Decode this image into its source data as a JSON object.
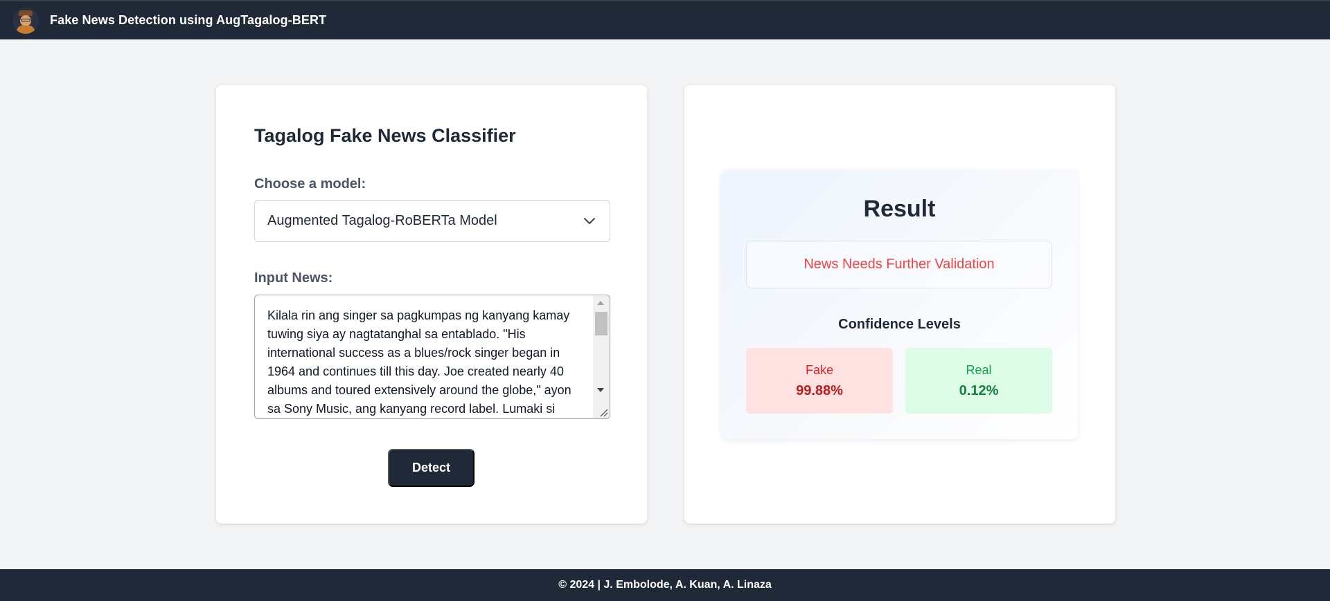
{
  "header": {
    "app_title": "Fake News Detection using AugTagalog-BERT",
    "logo_icon": "avatar-logo-icon"
  },
  "classifier": {
    "title": "Tagalog Fake News Classifier",
    "model_label": "Choose a model:",
    "model_selected": "Augmented Tagalog-RoBERTa Model",
    "news_label": "Input News:",
    "news_text": "Kilala rin ang singer sa pagkumpas ng kanyang kamay tuwing siya ay nagtatanghal sa entablado. \"His international success as a blues/rock singer began in 1964 and continues till this day. Joe created nearly 40 albums and toured extensively around the globe,\" ayon sa Sony Music, ang kanyang record label. Lumaki si",
    "detect_label": "Detect"
  },
  "result": {
    "title": "Result",
    "verdict": "News Needs Further Validation",
    "confidence_title": "Confidence Levels",
    "fake_label": "Fake",
    "fake_value": "99.88%",
    "real_label": "Real",
    "real_value": "0.12%"
  },
  "footer": {
    "text": "© 2024 | J. Embolode, A. Kuan, A. Linaza"
  },
  "colors": {
    "nav": "#1f2937",
    "background": "#f3f4f6",
    "verdict": "#ef4444",
    "fake_bg": "#fee2e2",
    "real_bg": "#dcfce7"
  }
}
